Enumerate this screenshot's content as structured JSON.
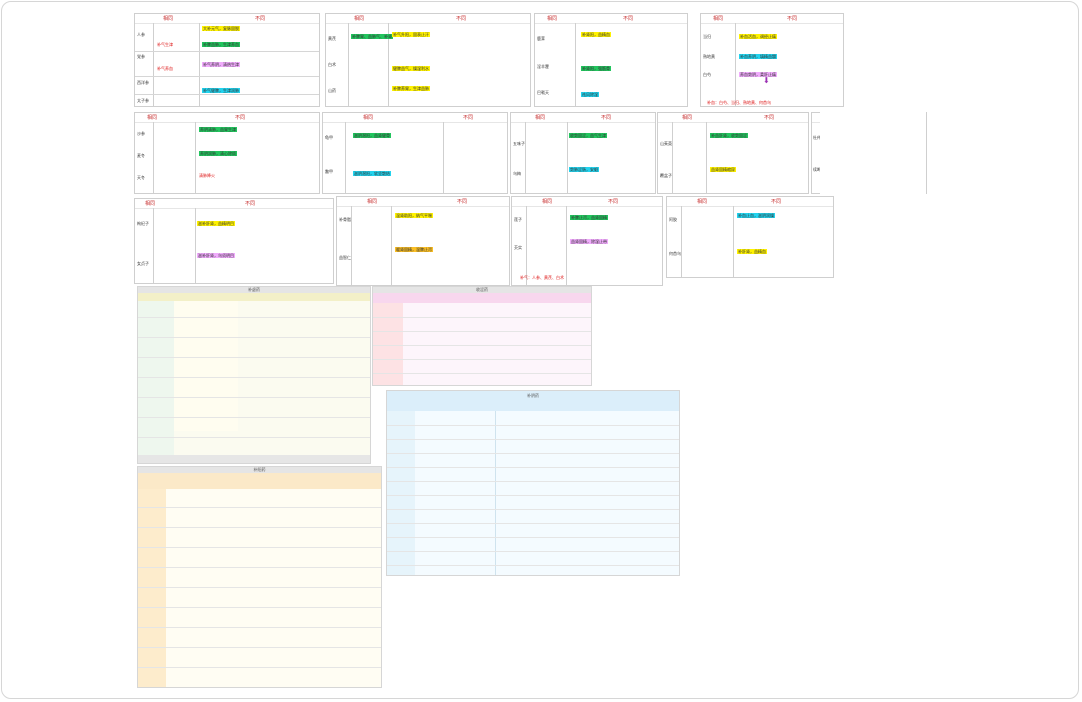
{
  "page": {
    "name": "tcm-comparison-tables-collage"
  },
  "tables": {
    "hdr_same": "相同",
    "hdr_diff": "不同",
    "t1": {
      "rows": [
        "人参",
        "党参",
        "西洋参",
        "太子参"
      ],
      "left": "补气生津",
      "left2": "补气养血",
      "cells": [
        "大补元气，复脉固脱",
        "补脾益肺，生津养血",
        "补气养阴，清热生津",
        "补气健脾，生津润肺"
      ]
    },
    "t2": {
      "rows": [
        "黄芪",
        "白术",
        "山药"
      ],
      "cells": [
        "补气升阳，固表止汗",
        "健脾益气，燥湿利水",
        "补脾养胃，生津益肺"
      ],
      "note": "补脾胃、益肺气、补肾"
    },
    "t3": {
      "rows": [
        "鹿茸",
        "淫羊藿",
        "巴戟天"
      ],
      "cells": [
        "补肾阳，益精血",
        "补肾阳，强筋骨",
        "祛风除湿"
      ]
    },
    "t4": {
      "rows": [
        "当归",
        "熟地黄",
        "白芍"
      ],
      "cells": [
        "补血活血，调经止痛",
        "补血养阴，填精益髓",
        "养血敛阴，柔肝止痛"
      ],
      "footer": "补血：白芍、当归、熟地黄、何首乌"
    },
    "t5": {
      "rows": [
        "沙参",
        "麦冬",
        "天冬"
      ],
      "cells": [
        "养阴清肺，益胃生津",
        "养阴润肺，清心除烦",
        "清肺降火"
      ]
    },
    "t6": {
      "rows": [
        "龟甲",
        "鳖甲"
      ],
      "cells": [
        "滋阴潜阳，益肾健骨",
        "滋阴潜阳，软坚散结"
      ]
    },
    "t7": {
      "rows": [
        "五味子",
        "乌梅"
      ],
      "cells": [
        "收敛固涩，益气生津",
        "敛肺涩肠，安蛔"
      ]
    },
    "t8": {
      "rows": [
        "山茱萸",
        "覆盆子"
      ],
      "cells": [
        "补益肝肾，收敛固涩",
        "益肾固精缩尿"
      ]
    },
    "t9": {
      "rows": [
        "杜仲",
        "续断"
      ],
      "cells": [
        "补肝肾，强筋骨，安胎",
        "补肝肾，续折伤"
      ]
    },
    "t10": {
      "rows": [
        "枸杞子",
        "女贞子"
      ],
      "cells": [
        "滋补肝肾，益精明目",
        "滋补肝肾，乌须明目"
      ]
    },
    "t11": {
      "rows": [
        "补骨脂",
        "益智仁"
      ],
      "cells": [
        "温肾助阳，纳气平喘",
        "暖肾固精，温脾止泻"
      ]
    },
    "t12": {
      "rows": [
        "莲子",
        "芡实"
      ],
      "cells": [
        "补脾止泻，益肾固精",
        "益肾固精，除湿止带"
      ],
      "footer": "固精缩尿止带：莲子、芡实、金樱子"
    },
    "t13": {
      "rows": [
        "阿胶",
        "何首乌"
      ],
      "cells": [
        "补血止血，滋阴润燥",
        "补肝肾，益精血"
      ]
    },
    "t14": {
      "rows": [
        "甘草",
        "大枣"
      ],
      "cells": [
        "补脾益气，调和诸药",
        "补中益气，养血安神"
      ],
      "footer": "补气：人参、黄芪、白术"
    }
  },
  "large": {
    "a": {
      "title": "补虚药"
    },
    "b": {
      "title": "收涩药"
    },
    "c": {
      "title": "补阳药"
    },
    "d": {
      "title": "补阴药"
    }
  }
}
